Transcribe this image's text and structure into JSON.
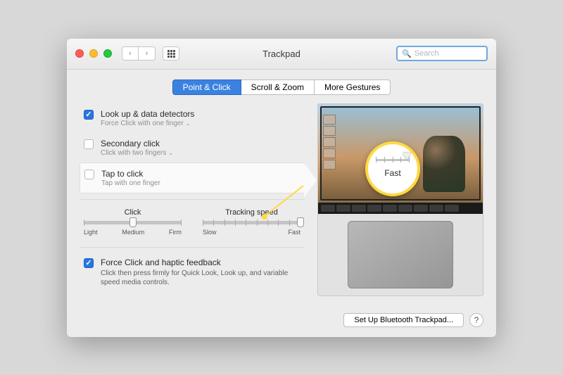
{
  "header": {
    "title": "Trackpad",
    "search_placeholder": "Search"
  },
  "tabs": [
    {
      "label": "Point & Click",
      "active": true
    },
    {
      "label": "Scroll & Zoom",
      "active": false
    },
    {
      "label": "More Gestures",
      "active": false
    }
  ],
  "options": {
    "lookup": {
      "title": "Look up & data detectors",
      "subtitle": "Force Click with one finger",
      "checked": true
    },
    "secondary": {
      "title": "Secondary click",
      "subtitle": "Click with two fingers",
      "checked": false
    },
    "tap": {
      "title": "Tap to click",
      "subtitle": "Tap with one finger",
      "checked": false
    }
  },
  "sliders": {
    "click": {
      "label": "Click",
      "marks": [
        "Light",
        "Medium",
        "Firm"
      ],
      "value_pct": 50
    },
    "tracking": {
      "label": "Tracking speed",
      "marks": [
        "Slow",
        "Fast"
      ],
      "value_pct": 100
    }
  },
  "force_click": {
    "title": "Force Click and haptic feedback",
    "desc": "Click then press firmly for Quick Look, Look up, and variable speed media controls.",
    "checked": true
  },
  "callout": {
    "label": "Fast"
  },
  "footer": {
    "bluetooth_btn": "Set Up Bluetooth Trackpad...",
    "help": "?"
  }
}
